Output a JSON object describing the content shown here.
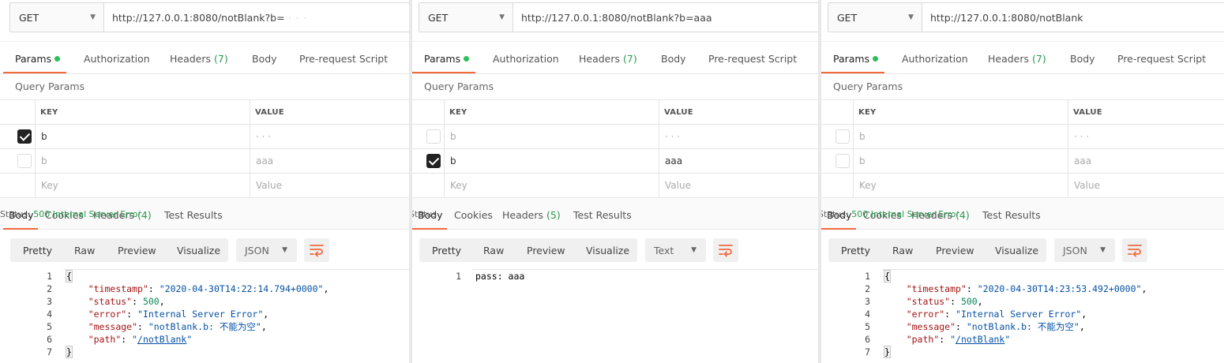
{
  "panels": [
    {
      "method": "GET",
      "url": "http://127.0.0.1:8080/notBlank?b=",
      "url_suffix": "· · ·",
      "request_tabs": {
        "params": "Params",
        "authorization": "Authorization",
        "headers": "Headers",
        "headers_count": "(7)",
        "body": "Body",
        "prerequest": "Pre-request Script"
      },
      "query_params_title": "Query Params",
      "columns": {
        "key": "KEY",
        "value": "VALUE"
      },
      "rows": [
        {
          "checked": true,
          "key": "b",
          "value": "· · ·",
          "dim_key": false,
          "dim_value": true
        },
        {
          "checked": false,
          "key": "b",
          "value": "aaa",
          "dim_key": true,
          "dim_value": true
        },
        {
          "placeholder": true,
          "key": "Key",
          "value": "Value"
        }
      ],
      "response_tabs": {
        "body": "Body",
        "cookies": "Cookies",
        "headers": "Headers",
        "headers_count": "(4)",
        "tests": "Test Results"
      },
      "status_label": "Status:",
      "status_value": "500 Internal Server Error",
      "format_tabs": [
        "Pretty",
        "Raw",
        "Preview",
        "Visualize"
      ],
      "format_select": "JSON",
      "code": [
        [
          {
            "t": "{",
            "c": "brace"
          }
        ],
        [
          {
            "t": "    "
          },
          {
            "t": "\"timestamp\"",
            "c": "k"
          },
          {
            "t": ": "
          },
          {
            "t": "\"2020-04-30T14:22:14.794+0000\"",
            "c": "s"
          },
          {
            "t": ","
          }
        ],
        [
          {
            "t": "    "
          },
          {
            "t": "\"status\"",
            "c": "k"
          },
          {
            "t": ": "
          },
          {
            "t": "500",
            "c": "n"
          },
          {
            "t": ","
          }
        ],
        [
          {
            "t": "    "
          },
          {
            "t": "\"error\"",
            "c": "k"
          },
          {
            "t": ": "
          },
          {
            "t": "\"Internal Server Error\"",
            "c": "s"
          },
          {
            "t": ","
          }
        ],
        [
          {
            "t": "    "
          },
          {
            "t": "\"message\"",
            "c": "k"
          },
          {
            "t": ": "
          },
          {
            "t": "\"notBlank.b: 不能为空\"",
            "c": "s"
          },
          {
            "t": ","
          }
        ],
        [
          {
            "t": "    "
          },
          {
            "t": "\"path\"",
            "c": "k"
          },
          {
            "t": ": "
          },
          {
            "t": "\"",
            "c": "s"
          },
          {
            "t": "/notBlank",
            "c": "s link"
          },
          {
            "t": "\"",
            "c": "s"
          }
        ],
        [
          {
            "t": "}",
            "c": "brace"
          }
        ]
      ]
    },
    {
      "method": "GET",
      "url": "http://127.0.0.1:8080/notBlank?b=aaa",
      "url_suffix": "",
      "request_tabs": {
        "params": "Params",
        "authorization": "Authorization",
        "headers": "Headers",
        "headers_count": "(7)",
        "body": "Body",
        "prerequest": "Pre-request Script"
      },
      "query_params_title": "Query Params",
      "columns": {
        "key": "KEY",
        "value": "VALUE"
      },
      "rows": [
        {
          "checked": false,
          "key": "b",
          "value": "· · ·",
          "dim_key": true,
          "dim_value": true
        },
        {
          "checked": true,
          "key": "b",
          "value": "aaa",
          "dim_key": false,
          "dim_value": false
        },
        {
          "placeholder": true,
          "key": "Key",
          "value": "Value"
        }
      ],
      "response_tabs": {
        "body": "Body",
        "cookies": "Cookies",
        "headers": "Headers",
        "headers_count": "(5)",
        "tests": "Test Results"
      },
      "status_label": "Status",
      "status_value": "",
      "format_tabs": [
        "Pretty",
        "Raw",
        "Preview",
        "Visualize"
      ],
      "format_select": "Text",
      "code": [
        [
          {
            "t": "pass: aaa"
          }
        ]
      ]
    },
    {
      "method": "GET",
      "url": "http://127.0.0.1:8080/notBlank",
      "url_suffix": "",
      "request_tabs": {
        "params": "Params",
        "authorization": "Authorization",
        "headers": "Headers",
        "headers_count": "(7)",
        "body": "Body",
        "prerequest": "Pre-request Script"
      },
      "query_params_title": "Query Params",
      "columns": {
        "key": "KEY",
        "value": "VALUE"
      },
      "rows": [
        {
          "checked": false,
          "key": "b",
          "value": "· · ·",
          "dim_key": true,
          "dim_value": true
        },
        {
          "checked": false,
          "key": "b",
          "value": "aaa",
          "dim_key": true,
          "dim_value": true
        },
        {
          "placeholder": true,
          "key": "Key",
          "value": "Value"
        }
      ],
      "response_tabs": {
        "body": "Body",
        "cookies": "Cookies",
        "headers": "Headers",
        "headers_count": "(4)",
        "tests": "Test Results"
      },
      "status_label": "Status:",
      "status_value": "500 Internal Server Error",
      "format_tabs": [
        "Pretty",
        "Raw",
        "Preview",
        "Visualize"
      ],
      "format_select": "JSON",
      "code": [
        [
          {
            "t": "{",
            "c": "brace"
          }
        ],
        [
          {
            "t": "    "
          },
          {
            "t": "\"timestamp\"",
            "c": "k"
          },
          {
            "t": ": "
          },
          {
            "t": "\"2020-04-30T14:23:53.492+0000\"",
            "c": "s"
          },
          {
            "t": ","
          }
        ],
        [
          {
            "t": "    "
          },
          {
            "t": "\"status\"",
            "c": "k"
          },
          {
            "t": ": "
          },
          {
            "t": "500",
            "c": "n"
          },
          {
            "t": ","
          }
        ],
        [
          {
            "t": "    "
          },
          {
            "t": "\"error\"",
            "c": "k"
          },
          {
            "t": ": "
          },
          {
            "t": "\"Internal Server Error\"",
            "c": "s"
          },
          {
            "t": ","
          }
        ],
        [
          {
            "t": "    "
          },
          {
            "t": "\"message\"",
            "c": "k"
          },
          {
            "t": ": "
          },
          {
            "t": "\"notBlank.b: 不能为空\"",
            "c": "s"
          },
          {
            "t": ","
          }
        ],
        [
          {
            "t": "    "
          },
          {
            "t": "\"path\"",
            "c": "k"
          },
          {
            "t": ": "
          },
          {
            "t": "\"",
            "c": "s"
          },
          {
            "t": "/notBlank",
            "c": "s link"
          },
          {
            "t": "\"",
            "c": "s"
          }
        ],
        [
          {
            "t": "}",
            "c": "brace"
          }
        ]
      ]
    }
  ]
}
